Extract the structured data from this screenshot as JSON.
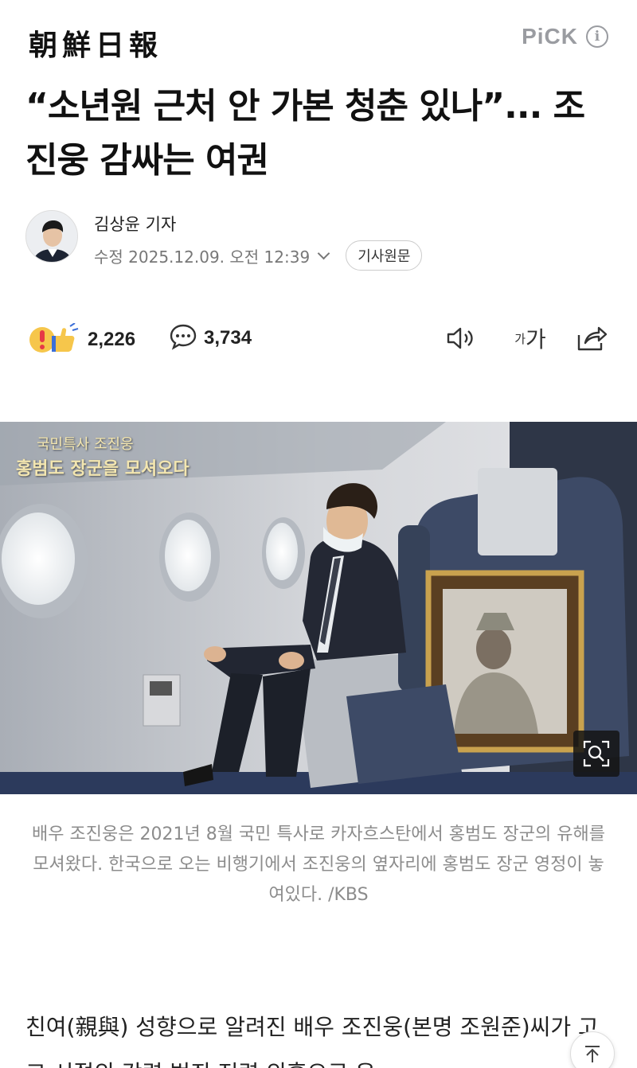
{
  "header": {
    "logo_text": "朝鮮日報",
    "pick_label": "PiCK",
    "info_icon": "info-icon"
  },
  "article": {
    "headline": "“소년원 근처 안 가본 청춘 있나”... 조진웅 감싸는 여권",
    "author": "김상윤 기자",
    "timestamp": "수정 2025.12.09. 오전 12:39",
    "original_button": "기사원문"
  },
  "actions": {
    "reaction_icon": "emoji-reaction-icon",
    "reaction_count": "2,226",
    "comment_icon": "comment-bubble-icon",
    "comment_count": "3,734",
    "listen_icon": "speaker-icon",
    "font_size_label_small": "가",
    "font_size_label_large": "가",
    "share_icon": "share-icon"
  },
  "photo": {
    "overlay_line1": "국민특사 조진웅",
    "overlay_line2": "홍범도 장군을 모셔오다",
    "zoom_icon": "zoom-icon"
  },
  "caption": "배우 조진웅은 2021년 8월 국민 특사로 카자흐스탄에서 홍범도 장군의 유해를 모셔왔다. 한국으로 오는 비행기에서 조진웅의 옆자리에 홍범도 장군 영정이 놓여있다. /KBS",
  "body": {
    "paragraph_visible": "친여(親與) 성향으로 알려진 배우 조진웅(본명 조원준)씨가 고교 시절의 강력 범죄 전력 의혹으로 은"
  },
  "colors": {
    "muted_text": "#8c8c8c",
    "pick_gray": "#9a9ca1",
    "emoji_yellow": "#f6c64b",
    "seat_navy": "#3d4a66"
  }
}
